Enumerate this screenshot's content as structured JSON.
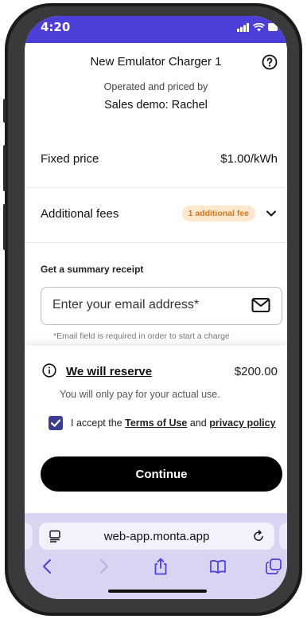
{
  "status": {
    "time": "4:20"
  },
  "charger": {
    "name": "New Emulator Charger 1"
  },
  "operator": {
    "label": "Operated and priced by",
    "name": "Sales demo: Rachel"
  },
  "pricing": {
    "label": "Fixed price",
    "value": "$1.00/kWh"
  },
  "fees": {
    "label": "Additional fees",
    "badge": "1 additional fee"
  },
  "receipt": {
    "label": "Get a summary receipt",
    "placeholder": "Enter your email address*",
    "value": "",
    "note": "*Email field is required in order to start a charge"
  },
  "reserve": {
    "link": "We will reserve",
    "amount": "$200.00",
    "note": "You will only pay for your actual use."
  },
  "terms": {
    "prefix": "I accept the ",
    "terms_link": "Terms of Use",
    "middle": " and ",
    "privacy_link": "privacy policy",
    "checked": true
  },
  "continue_label": "Continue",
  "browser": {
    "url": "web-app.monta.app"
  },
  "colors": {
    "accent": "#4b3fd8",
    "badge_bg": "#fde7cf",
    "badge_text": "#d07a1f",
    "checkbox": "#3b3e8f",
    "browser_bar": "#d8d4f2"
  },
  "icons": {
    "help": "question-circle-icon",
    "chevron": "chevron-down-icon",
    "mail": "mail-icon",
    "info": "info-icon",
    "check": "check-icon",
    "reader": "reader-mode-icon",
    "reload": "reload-icon",
    "back": "back-icon",
    "forward": "forward-icon",
    "share": "share-icon",
    "bookmarks": "bookmarks-icon",
    "tabs": "tabs-icon"
  }
}
